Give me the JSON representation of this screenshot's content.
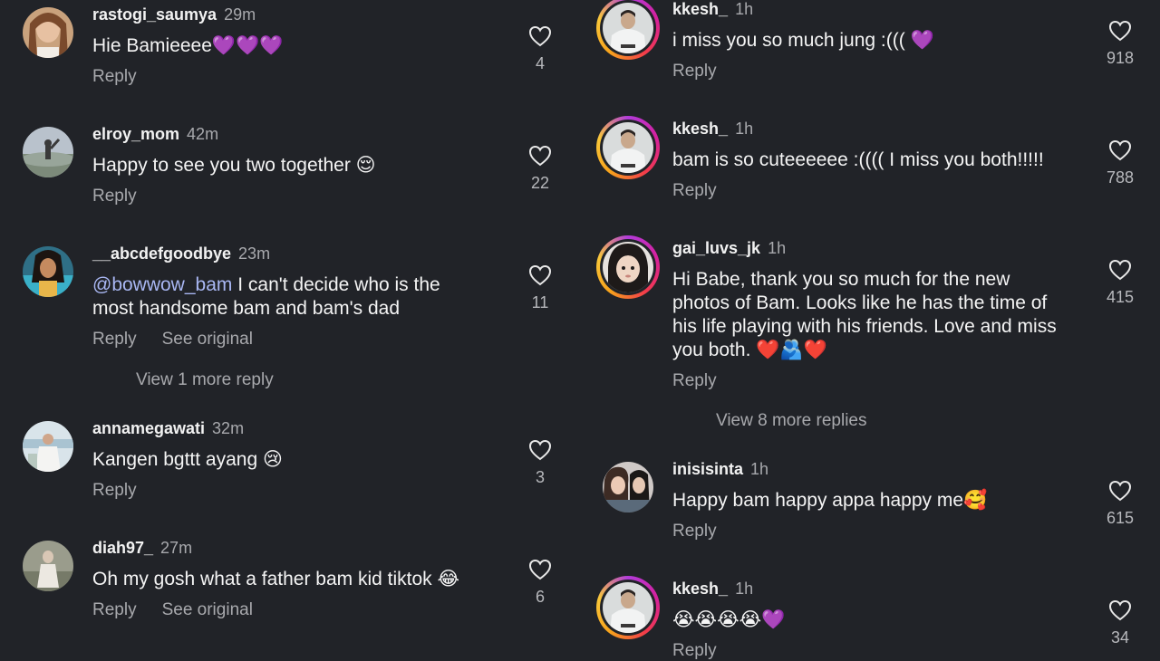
{
  "left_column": [
    {
      "username": "rastogi_saumya",
      "time": "29m",
      "text": "Hie Bamieeee💜💜💜",
      "reply": "Reply",
      "likes": "4"
    },
    {
      "username": "elroy_mom",
      "time": "42m",
      "text": "Happy to see you two together 😌",
      "reply": "Reply",
      "likes": "22"
    },
    {
      "username": "__abcdefgoodbye",
      "time": "23m",
      "mention": "@bowwow_bam",
      "text_line1": " I can't decide who is the",
      "text_line2": "most handsome bam and bam's dad",
      "reply": "Reply",
      "see_original": "See original",
      "view_more": "View 1 more reply",
      "likes": "11"
    },
    {
      "username": "annamegawati",
      "time": "32m",
      "text": "Kangen bgttt ayang 😢",
      "reply": "Reply",
      "likes": "3"
    },
    {
      "username": "diah97_",
      "time": "27m",
      "text": "Oh my gosh what a father bam kid tiktok 😂",
      "reply": "Reply",
      "see_original": "See original",
      "likes": "6"
    }
  ],
  "right_column": [
    {
      "username": "kkesh_",
      "time": "1h",
      "text": "i miss you so much jung :((( 💜",
      "reply": "Reply",
      "likes": "918"
    },
    {
      "username": "kkesh_",
      "time": "1h",
      "text": "bam is so cuteeeeee :(((( I miss you both!!!!!",
      "reply": "Reply",
      "likes": "788"
    },
    {
      "username": "gai_luvs_jk",
      "time": "1h",
      "text_line1": "Hi Babe, thank you so much for the new",
      "text_line2": "photos of Bam. Looks like he has the time of",
      "text_line3": "his life playing with his friends. Love and miss",
      "text_line4": "you both. ❤️🫂❤️",
      "reply": "Reply",
      "view_more": "View 8 more replies",
      "likes": "415"
    },
    {
      "username": "inisisinta",
      "time": "1h",
      "text": "Happy bam happy appa happy me🥰",
      "reply": "Reply",
      "likes": "615"
    },
    {
      "username": "kkesh_",
      "time": "1h",
      "text": "😭😭😭😭💜",
      "reply": "Reply",
      "likes": "34"
    }
  ],
  "icons": {
    "like": "heart-outline-icon"
  },
  "colors": {
    "background": "#212328",
    "secondary_text": "#a8a9ad",
    "mention": "#a9b7f3",
    "story_ring_start": "#b23bdb",
    "story_ring_end": "#f9c83a"
  }
}
